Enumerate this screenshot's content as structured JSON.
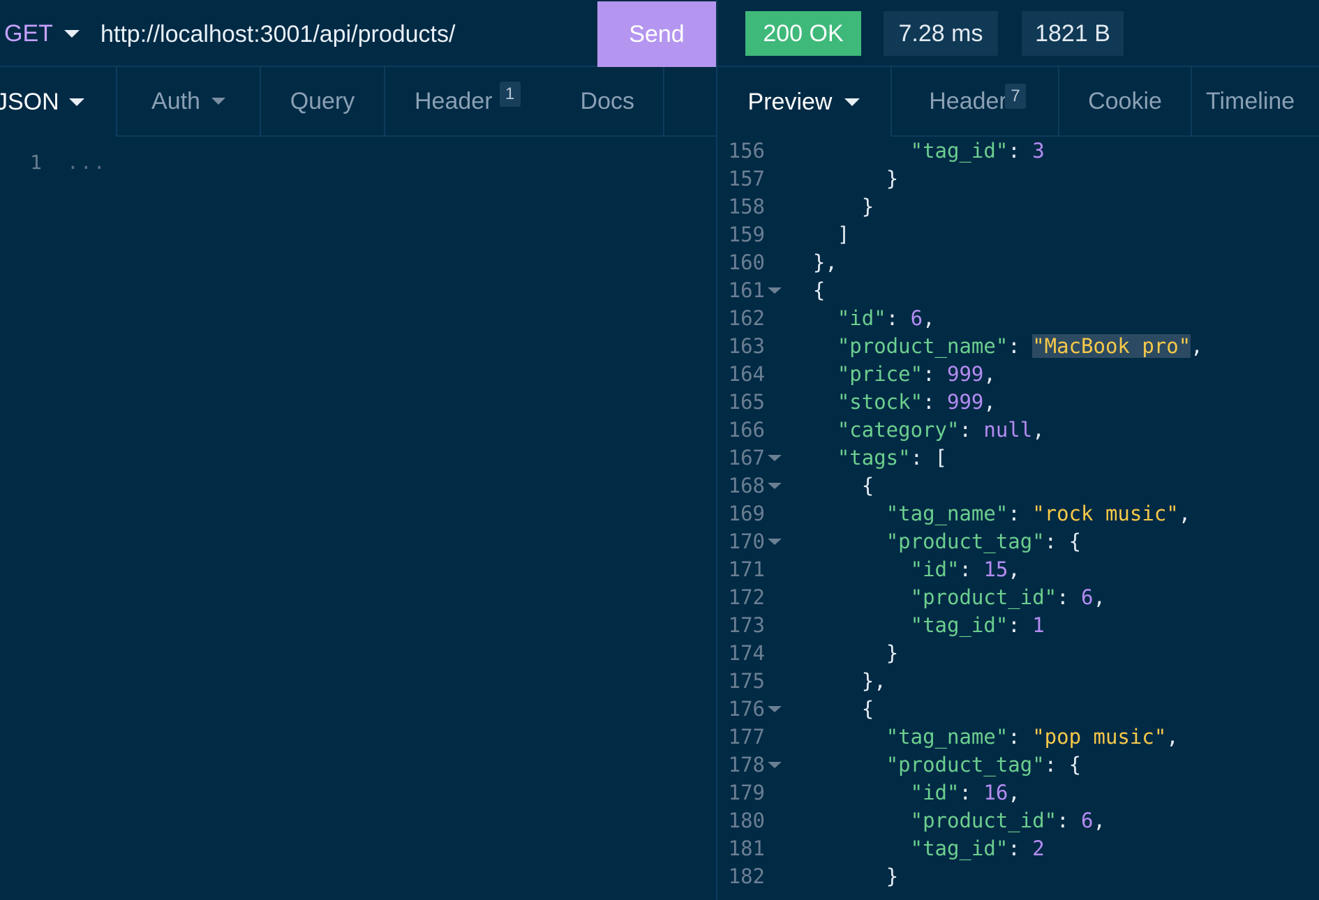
{
  "request": {
    "method": "GET",
    "url": "http://localhost:3001/api/products/",
    "send_label": "Send"
  },
  "status": {
    "code_text": "200 OK",
    "time": "7.28 ms",
    "size": "1821 B"
  },
  "request_tabs": {
    "body": "JSON",
    "auth": "Auth",
    "query": "Query",
    "header": "Header",
    "header_count": "1",
    "docs": "Docs"
  },
  "response_tabs": {
    "preview": "Preview",
    "header": "Header",
    "header_count": "7",
    "cookie": "Cookie",
    "timeline": "Timeline"
  },
  "request_editor": {
    "line_number": "1",
    "folded_text": "..."
  },
  "response_lines": [
    {
      "num": "156",
      "indent": "        ",
      "tokens": [
        [
          "k",
          "\"tag_id\""
        ],
        [
          "p",
          ": "
        ],
        [
          "n",
          "3"
        ]
      ]
    },
    {
      "num": "157",
      "indent": "      ",
      "tokens": [
        [
          "p",
          "}"
        ]
      ]
    },
    {
      "num": "158",
      "indent": "    ",
      "tokens": [
        [
          "p",
          "}"
        ]
      ]
    },
    {
      "num": "159",
      "indent": "  ",
      "tokens": [
        [
          "p",
          "]"
        ]
      ]
    },
    {
      "num": "160",
      "indent": "",
      "tokens": [
        [
          "p",
          "},"
        ]
      ]
    },
    {
      "num": "161",
      "indent": "",
      "fold": true,
      "tokens": [
        [
          "p",
          "{"
        ]
      ]
    },
    {
      "num": "162",
      "indent": "  ",
      "tokens": [
        [
          "k",
          "\"id\""
        ],
        [
          "p",
          ": "
        ],
        [
          "n",
          "6"
        ],
        [
          "p",
          ","
        ]
      ]
    },
    {
      "num": "163",
      "indent": "  ",
      "tokens": [
        [
          "k",
          "\"product_name\""
        ],
        [
          "p",
          ": "
        ],
        [
          "s hl",
          "\"MacBook pro\""
        ],
        [
          "p",
          ","
        ]
      ]
    },
    {
      "num": "164",
      "indent": "  ",
      "tokens": [
        [
          "k",
          "\"price\""
        ],
        [
          "p",
          ": "
        ],
        [
          "n",
          "999"
        ],
        [
          "p",
          ","
        ]
      ]
    },
    {
      "num": "165",
      "indent": "  ",
      "tokens": [
        [
          "k",
          "\"stock\""
        ],
        [
          "p",
          ": "
        ],
        [
          "n",
          "999"
        ],
        [
          "p",
          ","
        ]
      ]
    },
    {
      "num": "166",
      "indent": "  ",
      "tokens": [
        [
          "k",
          "\"category\""
        ],
        [
          "p",
          ": "
        ],
        [
          "n",
          "null"
        ],
        [
          "p",
          ","
        ]
      ]
    },
    {
      "num": "167",
      "indent": "  ",
      "fold": true,
      "tokens": [
        [
          "k",
          "\"tags\""
        ],
        [
          "p",
          ": ["
        ]
      ]
    },
    {
      "num": "168",
      "indent": "    ",
      "fold": true,
      "tokens": [
        [
          "p",
          "{"
        ]
      ]
    },
    {
      "num": "169",
      "indent": "      ",
      "tokens": [
        [
          "k",
          "\"tag_name\""
        ],
        [
          "p",
          ": "
        ],
        [
          "s",
          "\"rock music\""
        ],
        [
          "p",
          ","
        ]
      ]
    },
    {
      "num": "170",
      "indent": "      ",
      "fold": true,
      "tokens": [
        [
          "k",
          "\"product_tag\""
        ],
        [
          "p",
          ": {"
        ]
      ]
    },
    {
      "num": "171",
      "indent": "        ",
      "tokens": [
        [
          "k",
          "\"id\""
        ],
        [
          "p",
          ": "
        ],
        [
          "n",
          "15"
        ],
        [
          "p",
          ","
        ]
      ]
    },
    {
      "num": "172",
      "indent": "        ",
      "tokens": [
        [
          "k",
          "\"product_id\""
        ],
        [
          "p",
          ": "
        ],
        [
          "n",
          "6"
        ],
        [
          "p",
          ","
        ]
      ]
    },
    {
      "num": "173",
      "indent": "        ",
      "tokens": [
        [
          "k",
          "\"tag_id\""
        ],
        [
          "p",
          ": "
        ],
        [
          "n",
          "1"
        ]
      ]
    },
    {
      "num": "174",
      "indent": "      ",
      "tokens": [
        [
          "p",
          "}"
        ]
      ]
    },
    {
      "num": "175",
      "indent": "    ",
      "tokens": [
        [
          "p",
          "},"
        ]
      ]
    },
    {
      "num": "176",
      "indent": "    ",
      "fold": true,
      "tokens": [
        [
          "p",
          "{"
        ]
      ]
    },
    {
      "num": "177",
      "indent": "      ",
      "tokens": [
        [
          "k",
          "\"tag_name\""
        ],
        [
          "p",
          ": "
        ],
        [
          "s",
          "\"pop music\""
        ],
        [
          "p",
          ","
        ]
      ]
    },
    {
      "num": "178",
      "indent": "      ",
      "fold": true,
      "tokens": [
        [
          "k",
          "\"product_tag\""
        ],
        [
          "p",
          ": {"
        ]
      ]
    },
    {
      "num": "179",
      "indent": "        ",
      "tokens": [
        [
          "k",
          "\"id\""
        ],
        [
          "p",
          ": "
        ],
        [
          "n",
          "16"
        ],
        [
          "p",
          ","
        ]
      ]
    },
    {
      "num": "180",
      "indent": "        ",
      "tokens": [
        [
          "k",
          "\"product_id\""
        ],
        [
          "p",
          ": "
        ],
        [
          "n",
          "6"
        ],
        [
          "p",
          ","
        ]
      ]
    },
    {
      "num": "181",
      "indent": "        ",
      "tokens": [
        [
          "k",
          "\"tag_id\""
        ],
        [
          "p",
          ": "
        ],
        [
          "n",
          "2"
        ]
      ]
    },
    {
      "num": "182",
      "indent": "      ",
      "tokens": [
        [
          "p",
          "}"
        ]
      ]
    }
  ],
  "colors": {
    "background": "#012a45",
    "accent_send": "#b496f0",
    "status_ok": "#3fb97a",
    "method": "#c7a1ff",
    "json_key": "#6ccf8e",
    "json_number": "#b48cf2",
    "json_string": "#f7c948"
  }
}
